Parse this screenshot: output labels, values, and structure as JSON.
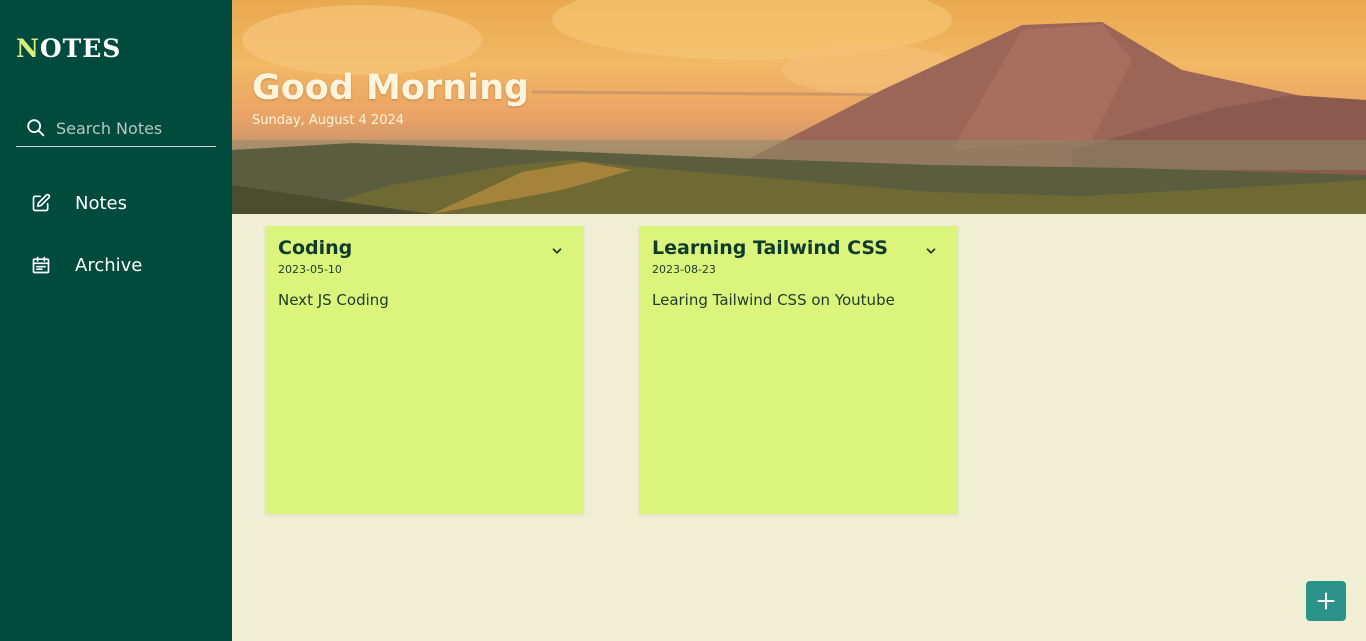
{
  "app": {
    "logo_first_letter": "N",
    "logo_rest": "OTES"
  },
  "colors": {
    "sidebar_bg": "#004a3e",
    "page_bg": "#f1eed6",
    "card_bg": "#dbf47c",
    "accent": "#2a9289",
    "logo_accent": "#d9ef7a"
  },
  "search": {
    "placeholder": "Search Notes",
    "value": "",
    "icon": "search-icon"
  },
  "nav": {
    "items": [
      {
        "label": "Notes",
        "icon": "edit-icon"
      },
      {
        "label": "Archive",
        "icon": "calendar-icon"
      }
    ]
  },
  "hero": {
    "greeting": "Good Morning",
    "date": "Sunday, August 4 2024"
  },
  "notes": [
    {
      "title": "Coding",
      "date": "2023-05-10",
      "body": "Next JS Coding",
      "menu_icon": "chevron-down-icon"
    },
    {
      "title": "Learning Tailwind CSS",
      "date": "2023-08-23",
      "body": "Learing Tailwind CSS on Youtube",
      "menu_icon": "chevron-down-icon"
    }
  ],
  "fab": {
    "icon": "plus-icon"
  }
}
